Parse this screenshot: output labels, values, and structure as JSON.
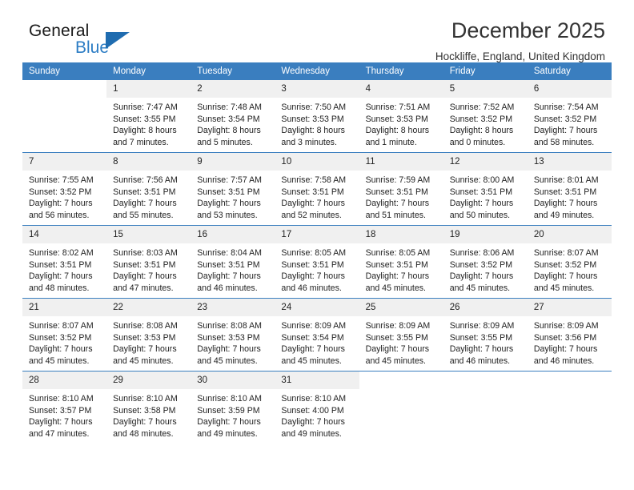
{
  "brand": {
    "name_top": "General",
    "name_bottom": "Blue",
    "triangle_color": "#1f6cb0",
    "text_color": "#2b7cc4"
  },
  "header": {
    "title": "December 2025",
    "subtitle": "Hockliffe, England, United Kingdom"
  },
  "theme": {
    "header_row_bg": "#3a7ebf",
    "header_row_text": "#ffffff",
    "daynum_bg": "#f0f0f0",
    "cell_bg": "#ffffff",
    "separator": "#3a7ebf"
  },
  "weekday_headers": [
    "Sunday",
    "Monday",
    "Tuesday",
    "Wednesday",
    "Thursday",
    "Friday",
    "Saturday"
  ],
  "weeks": [
    [
      {
        "day": "",
        "sunrise": "",
        "sunset": "",
        "daylight_line1": "",
        "daylight_line2": ""
      },
      {
        "day": "1",
        "sunrise": "Sunrise: 7:47 AM",
        "sunset": "Sunset: 3:55 PM",
        "daylight_line1": "Daylight: 8 hours",
        "daylight_line2": "and 7 minutes."
      },
      {
        "day": "2",
        "sunrise": "Sunrise: 7:48 AM",
        "sunset": "Sunset: 3:54 PM",
        "daylight_line1": "Daylight: 8 hours",
        "daylight_line2": "and 5 minutes."
      },
      {
        "day": "3",
        "sunrise": "Sunrise: 7:50 AM",
        "sunset": "Sunset: 3:53 PM",
        "daylight_line1": "Daylight: 8 hours",
        "daylight_line2": "and 3 minutes."
      },
      {
        "day": "4",
        "sunrise": "Sunrise: 7:51 AM",
        "sunset": "Sunset: 3:53 PM",
        "daylight_line1": "Daylight: 8 hours",
        "daylight_line2": "and 1 minute."
      },
      {
        "day": "5",
        "sunrise": "Sunrise: 7:52 AM",
        "sunset": "Sunset: 3:52 PM",
        "daylight_line1": "Daylight: 8 hours",
        "daylight_line2": "and 0 minutes."
      },
      {
        "day": "6",
        "sunrise": "Sunrise: 7:54 AM",
        "sunset": "Sunset: 3:52 PM",
        "daylight_line1": "Daylight: 7 hours",
        "daylight_line2": "and 58 minutes."
      }
    ],
    [
      {
        "day": "7",
        "sunrise": "Sunrise: 7:55 AM",
        "sunset": "Sunset: 3:52 PM",
        "daylight_line1": "Daylight: 7 hours",
        "daylight_line2": "and 56 minutes."
      },
      {
        "day": "8",
        "sunrise": "Sunrise: 7:56 AM",
        "sunset": "Sunset: 3:51 PM",
        "daylight_line1": "Daylight: 7 hours",
        "daylight_line2": "and 55 minutes."
      },
      {
        "day": "9",
        "sunrise": "Sunrise: 7:57 AM",
        "sunset": "Sunset: 3:51 PM",
        "daylight_line1": "Daylight: 7 hours",
        "daylight_line2": "and 53 minutes."
      },
      {
        "day": "10",
        "sunrise": "Sunrise: 7:58 AM",
        "sunset": "Sunset: 3:51 PM",
        "daylight_line1": "Daylight: 7 hours",
        "daylight_line2": "and 52 minutes."
      },
      {
        "day": "11",
        "sunrise": "Sunrise: 7:59 AM",
        "sunset": "Sunset: 3:51 PM",
        "daylight_line1": "Daylight: 7 hours",
        "daylight_line2": "and 51 minutes."
      },
      {
        "day": "12",
        "sunrise": "Sunrise: 8:00 AM",
        "sunset": "Sunset: 3:51 PM",
        "daylight_line1": "Daylight: 7 hours",
        "daylight_line2": "and 50 minutes."
      },
      {
        "day": "13",
        "sunrise": "Sunrise: 8:01 AM",
        "sunset": "Sunset: 3:51 PM",
        "daylight_line1": "Daylight: 7 hours",
        "daylight_line2": "and 49 minutes."
      }
    ],
    [
      {
        "day": "14",
        "sunrise": "Sunrise: 8:02 AM",
        "sunset": "Sunset: 3:51 PM",
        "daylight_line1": "Daylight: 7 hours",
        "daylight_line2": "and 48 minutes."
      },
      {
        "day": "15",
        "sunrise": "Sunrise: 8:03 AM",
        "sunset": "Sunset: 3:51 PM",
        "daylight_line1": "Daylight: 7 hours",
        "daylight_line2": "and 47 minutes."
      },
      {
        "day": "16",
        "sunrise": "Sunrise: 8:04 AM",
        "sunset": "Sunset: 3:51 PM",
        "daylight_line1": "Daylight: 7 hours",
        "daylight_line2": "and 46 minutes."
      },
      {
        "day": "17",
        "sunrise": "Sunrise: 8:05 AM",
        "sunset": "Sunset: 3:51 PM",
        "daylight_line1": "Daylight: 7 hours",
        "daylight_line2": "and 46 minutes."
      },
      {
        "day": "18",
        "sunrise": "Sunrise: 8:05 AM",
        "sunset": "Sunset: 3:51 PM",
        "daylight_line1": "Daylight: 7 hours",
        "daylight_line2": "and 45 minutes."
      },
      {
        "day": "19",
        "sunrise": "Sunrise: 8:06 AM",
        "sunset": "Sunset: 3:52 PM",
        "daylight_line1": "Daylight: 7 hours",
        "daylight_line2": "and 45 minutes."
      },
      {
        "day": "20",
        "sunrise": "Sunrise: 8:07 AM",
        "sunset": "Sunset: 3:52 PM",
        "daylight_line1": "Daylight: 7 hours",
        "daylight_line2": "and 45 minutes."
      }
    ],
    [
      {
        "day": "21",
        "sunrise": "Sunrise: 8:07 AM",
        "sunset": "Sunset: 3:52 PM",
        "daylight_line1": "Daylight: 7 hours",
        "daylight_line2": "and 45 minutes."
      },
      {
        "day": "22",
        "sunrise": "Sunrise: 8:08 AM",
        "sunset": "Sunset: 3:53 PM",
        "daylight_line1": "Daylight: 7 hours",
        "daylight_line2": "and 45 minutes."
      },
      {
        "day": "23",
        "sunrise": "Sunrise: 8:08 AM",
        "sunset": "Sunset: 3:53 PM",
        "daylight_line1": "Daylight: 7 hours",
        "daylight_line2": "and 45 minutes."
      },
      {
        "day": "24",
        "sunrise": "Sunrise: 8:09 AM",
        "sunset": "Sunset: 3:54 PM",
        "daylight_line1": "Daylight: 7 hours",
        "daylight_line2": "and 45 minutes."
      },
      {
        "day": "25",
        "sunrise": "Sunrise: 8:09 AM",
        "sunset": "Sunset: 3:55 PM",
        "daylight_line1": "Daylight: 7 hours",
        "daylight_line2": "and 45 minutes."
      },
      {
        "day": "26",
        "sunrise": "Sunrise: 8:09 AM",
        "sunset": "Sunset: 3:55 PM",
        "daylight_line1": "Daylight: 7 hours",
        "daylight_line2": "and 46 minutes."
      },
      {
        "day": "27",
        "sunrise": "Sunrise: 8:09 AM",
        "sunset": "Sunset: 3:56 PM",
        "daylight_line1": "Daylight: 7 hours",
        "daylight_line2": "and 46 minutes."
      }
    ],
    [
      {
        "day": "28",
        "sunrise": "Sunrise: 8:10 AM",
        "sunset": "Sunset: 3:57 PM",
        "daylight_line1": "Daylight: 7 hours",
        "daylight_line2": "and 47 minutes."
      },
      {
        "day": "29",
        "sunrise": "Sunrise: 8:10 AM",
        "sunset": "Sunset: 3:58 PM",
        "daylight_line1": "Daylight: 7 hours",
        "daylight_line2": "and 48 minutes."
      },
      {
        "day": "30",
        "sunrise": "Sunrise: 8:10 AM",
        "sunset": "Sunset: 3:59 PM",
        "daylight_line1": "Daylight: 7 hours",
        "daylight_line2": "and 49 minutes."
      },
      {
        "day": "31",
        "sunrise": "Sunrise: 8:10 AM",
        "sunset": "Sunset: 4:00 PM",
        "daylight_line1": "Daylight: 7 hours",
        "daylight_line2": "and 49 minutes."
      },
      {
        "day": "",
        "sunrise": "",
        "sunset": "",
        "daylight_line1": "",
        "daylight_line2": ""
      },
      {
        "day": "",
        "sunrise": "",
        "sunset": "",
        "daylight_line1": "",
        "daylight_line2": ""
      },
      {
        "day": "",
        "sunrise": "",
        "sunset": "",
        "daylight_line1": "",
        "daylight_line2": ""
      }
    ]
  ]
}
